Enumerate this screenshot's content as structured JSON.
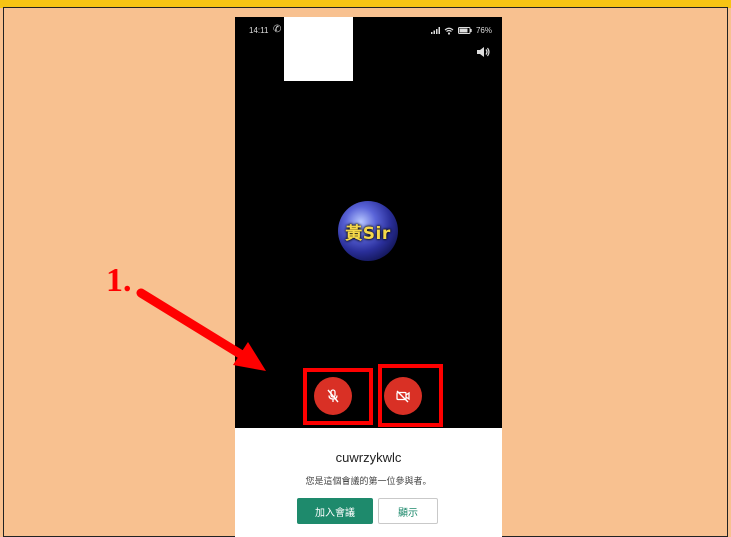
{
  "annotation": {
    "step_label": "1.",
    "color": "#ff0000"
  },
  "status_bar": {
    "time": "14:11",
    "battery": "76%",
    "icons": [
      "whatsapp-icon",
      "signal-icon",
      "wifi-icon",
      "battery-icon"
    ]
  },
  "call": {
    "avatar_text": "黃Sir"
  },
  "controls": {
    "mic": {
      "state": "muted",
      "icon": "mic-off-icon",
      "color": "#d93025"
    },
    "camera": {
      "state": "off",
      "icon": "camera-off-icon",
      "color": "#d93025"
    }
  },
  "meeting": {
    "code": "cuwrzykwlc",
    "first_participant_text": "您是這個會議的第一位參與者。",
    "join_label": "加入會議",
    "present_label": "顯示",
    "accent": "#1e8a6c"
  }
}
